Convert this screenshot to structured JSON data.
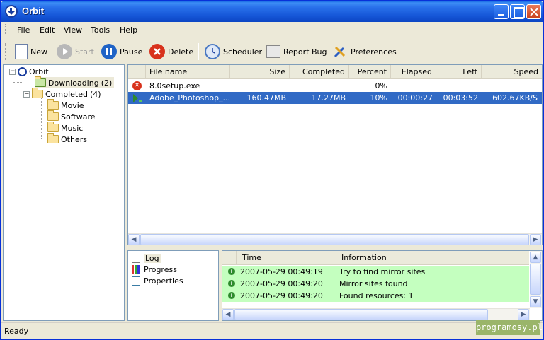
{
  "window": {
    "title": "Orbit"
  },
  "menu": [
    "File",
    "Edit",
    "View",
    "Tools",
    "Help"
  ],
  "toolbar": {
    "new": "New",
    "start": "Start",
    "pause": "Pause",
    "delete": "Delete",
    "scheduler": "Scheduler",
    "report_bug": "Report Bug",
    "preferences": "Preferences"
  },
  "tree": {
    "root": "Orbit",
    "downloading": "Downloading",
    "downloading_count": "(2)",
    "completed": "Completed",
    "completed_count": "(4)",
    "folders": [
      "Movie",
      "Software",
      "Music",
      "Others"
    ]
  },
  "downloads": {
    "columns": [
      "File name",
      "Size",
      "Completed",
      "Percent",
      "Elapsed",
      "Left",
      "Speed"
    ],
    "rows": [
      {
        "name": "8.0setup.exe",
        "size": "",
        "completed": "",
        "percent": "0%",
        "elapsed": "",
        "left": "",
        "speed": "",
        "status": "error"
      },
      {
        "name": "Adobe_Photoshop_...",
        "size": "160.47MB",
        "completed": "17.27MB",
        "percent": "10%",
        "elapsed": "00:00:27",
        "left": "00:03:52",
        "speed": "602.67KB/S",
        "status": "downloading"
      }
    ]
  },
  "details_tabs": [
    "Log",
    "Progress",
    "Properties"
  ],
  "log": {
    "columns": [
      "Time",
      "Information"
    ],
    "rows": [
      {
        "time": "2007-05-29 00:49:19",
        "info": "Try to find mirror sites"
      },
      {
        "time": "2007-05-29 00:49:20",
        "info": "Mirror sites found"
      },
      {
        "time": "2007-05-29 00:49:20",
        "info": "Found resources: 1"
      }
    ]
  },
  "status": {
    "text": "Ready"
  },
  "watermark": "programosy.pl",
  "colors": {
    "selection": "#316ac5",
    "log_row": "#c4ffbf",
    "title_bar": "#1657d8"
  }
}
